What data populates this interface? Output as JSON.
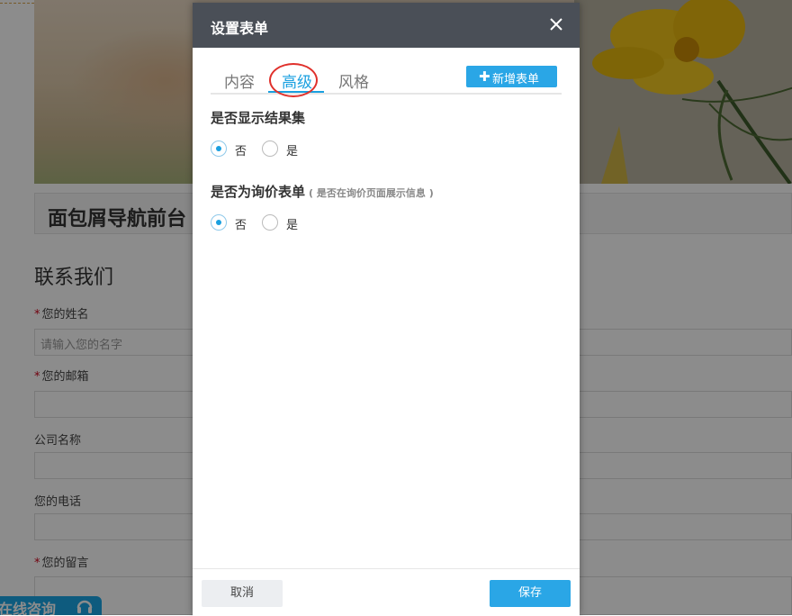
{
  "background": {
    "breadcrumb_title": "面包屑导航前台",
    "contact_title": "联系我们",
    "fields": [
      {
        "label": "您的姓名",
        "required": true,
        "placeholder": "请输入您的名字"
      },
      {
        "label": "您的邮箱",
        "required": true,
        "placeholder": ""
      },
      {
        "label": "公司名称",
        "required": false,
        "placeholder": ""
      },
      {
        "label": "您的电话",
        "required": false,
        "placeholder": ""
      },
      {
        "label": "您的留言",
        "required": true,
        "placeholder": ""
      }
    ],
    "required_mark": "*",
    "chat_tab_label": "在线咨询",
    "chat_icon": "headset-icon"
  },
  "modal": {
    "title": "设置表单",
    "close_icon": "close-icon",
    "tabs": [
      {
        "label": "内容",
        "active": false
      },
      {
        "label": "高级",
        "active": true
      },
      {
        "label": "风格",
        "active": false
      }
    ],
    "add_form_button": {
      "icon": "plus-icon",
      "label": "新增表单"
    },
    "sections": [
      {
        "title": "是否显示结果集",
        "note": "",
        "options": [
          {
            "label": "否",
            "checked": true
          },
          {
            "label": "是",
            "checked": false
          }
        ]
      },
      {
        "title": "是否为询价表单",
        "note": "( 是否在询价页面展示信息 )",
        "options": [
          {
            "label": "否",
            "checked": true
          },
          {
            "label": "是",
            "checked": false
          }
        ]
      }
    ],
    "footer": {
      "cancel_label": "取消",
      "save_label": "保存"
    }
  },
  "colors": {
    "accent": "#1aa0e0",
    "header_bg": "#4a4f57",
    "annotation_circle": "#e0302b"
  }
}
